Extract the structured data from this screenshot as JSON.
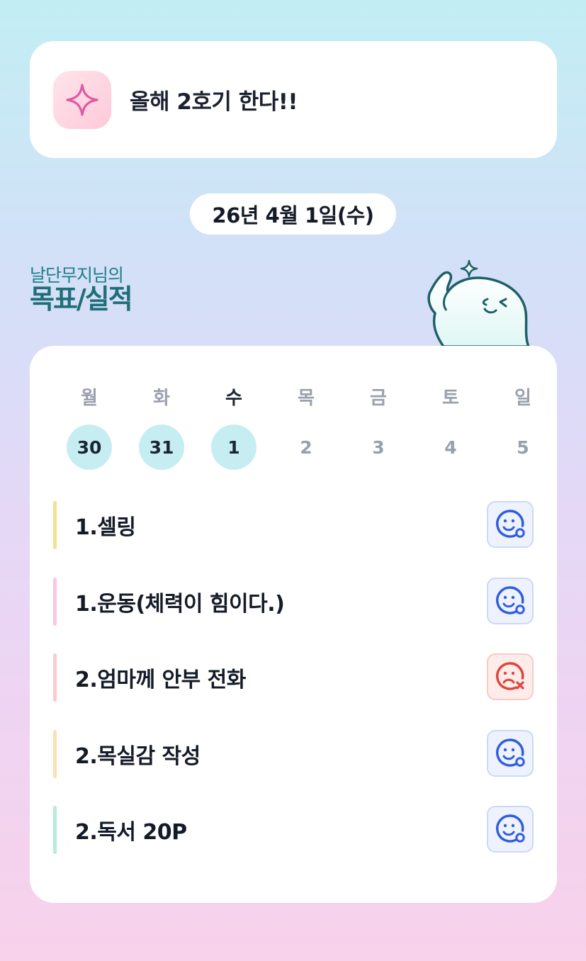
{
  "banner": {
    "icon": "sparkle-icon",
    "text": "올해 2호기 한다!!"
  },
  "date_label": "26년 4월 1일(수)",
  "owner": {
    "name_line": "날단무지님의",
    "heading": "목표/실적"
  },
  "week": {
    "weekdays": [
      "월",
      "화",
      "수",
      "목",
      "금",
      "토",
      "일"
    ],
    "days": [
      "30",
      "31",
      "1",
      "2",
      "3",
      "4",
      "5"
    ],
    "today_index": 2
  },
  "goals": [
    {
      "text": "1.셀링",
      "bar_color": "#f6df90",
      "status": "done",
      "status_icon": "smile-check-icon"
    },
    {
      "text": "1.운동(체력이 힘이다.)",
      "bar_color": "#f9c8e3",
      "status": "done",
      "status_icon": "smile-check-icon"
    },
    {
      "text": "2.엄마께 안부 전화",
      "bar_color": "#f9cccb",
      "status": "miss",
      "status_icon": "frown-x-icon"
    },
    {
      "text": "2.목실감 작성",
      "bar_color": "#fbe0b3",
      "status": "done",
      "status_icon": "smile-check-icon"
    },
    {
      "text": "2.독서 20P",
      "bar_color": "#b6ecd8",
      "status": "done",
      "status_icon": "smile-check-icon"
    }
  ],
  "colors": {
    "accent_teal": "#1f6f78",
    "done_blue": "#2f5de0",
    "miss_red": "#e0453a"
  }
}
